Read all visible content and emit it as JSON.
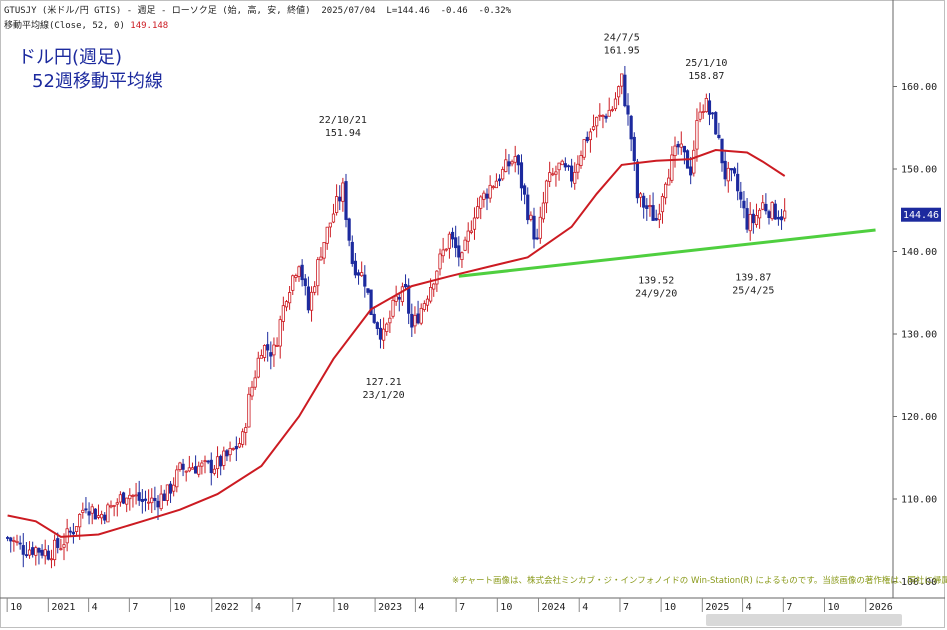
{
  "header": {
    "line1": "GTUSJY (米ドル/円 GTIS) - 週足 - ローソク足 (始, 高, 安, 終値)  2025/07/04  L=144.46  -0.46  -0.32%",
    "line2_label": "移動平均線(Close, 52, 0)",
    "line2_value": "149.148"
  },
  "title": {
    "line1": "ドル円(週足)",
    "line2": "52週移動平均線"
  },
  "credit": "※チャート画像は、株式会社ミンカブ・ジ・インフォノイドの Win-Station(R) によるものです。当該画像の著作権は、同社に帰属します。",
  "current_price_label": "144.46",
  "colors": {
    "candle": "#cc1b22",
    "candle_down": "#1c2a9e",
    "ma": "#cc1b22",
    "trendline": "#4fcf3f",
    "title": "#1c2a9e",
    "price_badge": "#1c2a9e"
  },
  "chart_data": {
    "type": "line",
    "instrument": "USD/JPY weekly candlestick",
    "x_axis": {
      "tick_labels": [
        "10",
        "2021",
        "4",
        "7",
        "10",
        "2022",
        "4",
        "7",
        "10",
        "2023",
        "4",
        "7",
        "10",
        "2024",
        "4",
        "7",
        "10",
        "2025",
        "4",
        "7",
        "10",
        "2026"
      ],
      "range": [
        "2020-10",
        "2026-01"
      ]
    },
    "y_axis": {
      "tick_labels": [
        "100.00",
        "110.00",
        "120.00",
        "130.00",
        "140.00",
        "150.00",
        "160.00"
      ],
      "range": [
        98,
        170
      ],
      "position": "right"
    },
    "grid": false,
    "annotations": [
      {
        "date": "22/10/21",
        "price": "151.94",
        "x": "2022-10-21",
        "y": 151.94,
        "kind": "high"
      },
      {
        "date": "23/1/20",
        "price": "127.21",
        "x": "2023-01-20",
        "y": 127.21,
        "kind": "low"
      },
      {
        "date": "24/7/5",
        "price": "161.95",
        "x": "2024-07-05",
        "y": 161.95,
        "kind": "high"
      },
      {
        "date": "24/9/20",
        "price": "139.52",
        "x": "2024-09-20",
        "y": 139.52,
        "kind": "low"
      },
      {
        "date": "25/1/10",
        "price": "158.87",
        "x": "2025-01-10",
        "y": 158.87,
        "kind": "high"
      },
      {
        "date": "25/4/25",
        "price": "139.87",
        "x": "2025-04-25",
        "y": 139.87,
        "kind": "low"
      }
    ],
    "price_path": [
      [
        "2020-10-02",
        105.3
      ],
      [
        "2020-11-06",
        104.0
      ],
      [
        "2020-12-04",
        104.0
      ],
      [
        "2021-01-01",
        103.5
      ],
      [
        "2021-01-29",
        104.5
      ],
      [
        "2021-02-26",
        106.4
      ],
      [
        "2021-03-26",
        109.5
      ],
      [
        "2021-04-23",
        107.9
      ],
      [
        "2021-05-21",
        108.9
      ],
      [
        "2021-06-25",
        110.8
      ],
      [
        "2021-07-30",
        109.7
      ],
      [
        "2021-08-27",
        109.8
      ],
      [
        "2021-09-24",
        110.7
      ],
      [
        "2021-10-22",
        113.5
      ],
      [
        "2021-11-19",
        114.0
      ],
      [
        "2021-12-17",
        113.8
      ],
      [
        "2022-01-14",
        114.2
      ],
      [
        "2022-02-11",
        115.4
      ],
      [
        "2022-03-11",
        117.3
      ],
      [
        "2022-03-25",
        122.0
      ],
      [
        "2022-04-22",
        128.5
      ],
      [
        "2022-05-20",
        127.9
      ],
      [
        "2022-06-17",
        135.0
      ],
      [
        "2022-07-15",
        139.0
      ],
      [
        "2022-08-05",
        133.0
      ],
      [
        "2022-09-02",
        140.2
      ],
      [
        "2022-09-30",
        144.7
      ],
      [
        "2022-10-21",
        147.5
      ],
      [
        "2022-11-11",
        138.8
      ],
      [
        "2022-12-09",
        136.6
      ],
      [
        "2022-12-23",
        132.8
      ],
      [
        "2023-01-20",
        129.6
      ],
      [
        "2023-02-17",
        134.2
      ],
      [
        "2023-03-10",
        135.0
      ],
      [
        "2023-03-24",
        130.7
      ],
      [
        "2023-04-21",
        134.0
      ],
      [
        "2023-05-19",
        138.0
      ],
      [
        "2023-06-16",
        141.8
      ],
      [
        "2023-07-14",
        138.8
      ],
      [
        "2023-08-11",
        144.9
      ],
      [
        "2023-09-15",
        147.9
      ],
      [
        "2023-10-13",
        149.6
      ],
      [
        "2023-11-10",
        151.5
      ],
      [
        "2023-12-08",
        144.9
      ],
      [
        "2023-12-29",
        141.0
      ],
      [
        "2024-01-19",
        148.1
      ],
      [
        "2024-02-16",
        150.2
      ],
      [
        "2024-03-15",
        149.0
      ],
      [
        "2024-04-12",
        153.3
      ],
      [
        "2024-05-10",
        155.8
      ],
      [
        "2024-06-14",
        157.4
      ],
      [
        "2024-07-05",
        160.8
      ],
      [
        "2024-07-26",
        153.8
      ],
      [
        "2024-08-09",
        146.6
      ],
      [
        "2024-09-20",
        143.9
      ],
      [
        "2024-10-11",
        149.1
      ],
      [
        "2024-11-08",
        152.6
      ],
      [
        "2024-12-06",
        150.0
      ],
      [
        "2024-12-27",
        157.8
      ],
      [
        "2025-01-10",
        157.7
      ],
      [
        "2025-01-31",
        155.0
      ],
      [
        "2025-02-21",
        149.3
      ],
      [
        "2025-03-14",
        148.6
      ],
      [
        "2025-04-11",
        143.5
      ],
      [
        "2025-04-25",
        143.7
      ],
      [
        "2025-05-16",
        145.7
      ],
      [
        "2025-06-06",
        144.9
      ],
      [
        "2025-06-27",
        144.5
      ],
      [
        "2025-07-04",
        144.46
      ]
    ],
    "series": [
      {
        "name": "移動平均線(Close, 52, 0)",
        "points": [
          [
            "2020-10-02",
            108.0
          ],
          [
            "2020-12-04",
            107.3
          ],
          [
            "2021-01-29",
            105.4
          ],
          [
            "2021-04-23",
            105.7
          ],
          [
            "2021-07-30",
            107.3
          ],
          [
            "2021-10-22",
            108.7
          ],
          [
            "2022-01-14",
            110.6
          ],
          [
            "2022-04-22",
            114.0
          ],
          [
            "2022-07-15",
            120.0
          ],
          [
            "2022-09-30",
            127.0
          ],
          [
            "2022-12-23",
            133.0
          ],
          [
            "2023-03-24",
            135.8
          ],
          [
            "2023-06-16",
            137.0
          ],
          [
            "2023-09-15",
            138.2
          ],
          [
            "2023-12-08",
            139.3
          ],
          [
            "2024-03-15",
            143.0
          ],
          [
            "2024-05-10",
            147.0
          ],
          [
            "2024-07-05",
            150.5
          ],
          [
            "2024-09-20",
            151.0
          ],
          [
            "2024-12-06",
            151.2
          ],
          [
            "2025-01-31",
            152.3
          ],
          [
            "2025-04-11",
            152.0
          ],
          [
            "2025-05-16",
            150.9
          ],
          [
            "2025-07-04",
            149.148
          ]
        ]
      },
      {
        "name": "",
        "points": [
          [
            "2023-07-07",
            137.0
          ],
          [
            "2026-01-23",
            142.6
          ]
        ]
      }
    ]
  }
}
